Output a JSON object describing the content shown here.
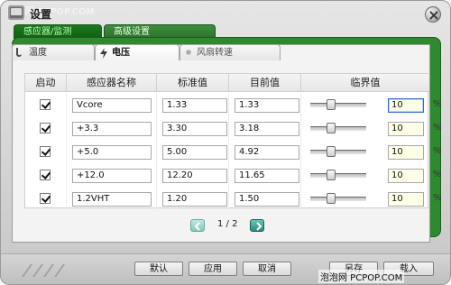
{
  "window": {
    "title": "设置",
    "watermark_top": "泡泡网 PCPOP.COM",
    "watermark_bottom": "泡泡网 PCPOP.COM"
  },
  "top_tabs": [
    {
      "label": "感应器/监测",
      "active": true
    },
    {
      "label": "高级设置",
      "active": false
    }
  ],
  "sub_tabs": [
    {
      "label": "温度"
    },
    {
      "label": "电压",
      "active": true
    },
    {
      "label": "风扇转速"
    }
  ],
  "table": {
    "headers": [
      "启动",
      "感应器名称",
      "标准值",
      "目前值",
      "临界值"
    ],
    "rows": [
      {
        "enabled": true,
        "name": "Vcore",
        "standard": "1.33",
        "current": "1.33",
        "threshold": "10",
        "unit": "%",
        "threshold_level": 0.35,
        "active": true
      },
      {
        "enabled": true,
        "name": "+3.3",
        "standard": "3.30",
        "current": "3.18",
        "threshold": "10",
        "unit": "%",
        "threshold_level": 0.35
      },
      {
        "enabled": true,
        "name": "+5.0",
        "standard": "5.00",
        "current": "4.92",
        "threshold": "10",
        "unit": "%",
        "threshold_level": 0.35
      },
      {
        "enabled": true,
        "name": "+12.0",
        "standard": "12.20",
        "current": "11.65",
        "threshold": "10",
        "unit": "%",
        "threshold_level": 0.35
      },
      {
        "enabled": true,
        "name": "1.2VHT",
        "standard": "1.20",
        "current": "1.50",
        "threshold": "10",
        "unit": "%",
        "threshold_level": 0.35
      }
    ]
  },
  "pager": {
    "text": "1 / 2"
  },
  "buttons": {
    "default": "默认",
    "apply": "应用",
    "cancel": "取消",
    "save": "另存",
    "load": "载入"
  },
  "colors": {
    "green_frame": "#2f8a2f",
    "threshold_bg": "#ffffe8",
    "pager_teal": "#2b8d7f"
  }
}
